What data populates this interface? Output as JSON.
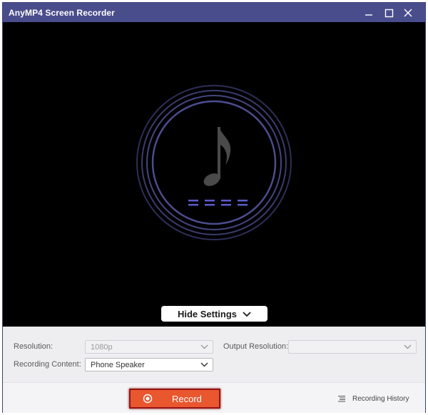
{
  "window": {
    "title": "AnyMP4 Screen Recorder",
    "controls": {
      "minimize_icon": "minimize-icon",
      "maximize_icon": "maximize-icon",
      "close_icon": "close-icon"
    }
  },
  "preview": {
    "icon": "music-note-icon",
    "hide_settings_label": "Hide Settings",
    "colors": {
      "background": "#000000",
      "ring": "#4b4d8e",
      "equalizer": "#5a5cc8"
    }
  },
  "settings": {
    "resolution_label": "Resolution:",
    "resolution_value": "1080p",
    "output_resolution_label": "Output Resolution:",
    "output_resolution_value": "",
    "recording_content_label": "Recording Content:",
    "recording_content_value": "Phone Speaker"
  },
  "bottom": {
    "record_label": "Record",
    "record_color": "#e8572e",
    "history_label": "Recording History",
    "history_icon": "list-icon"
  }
}
